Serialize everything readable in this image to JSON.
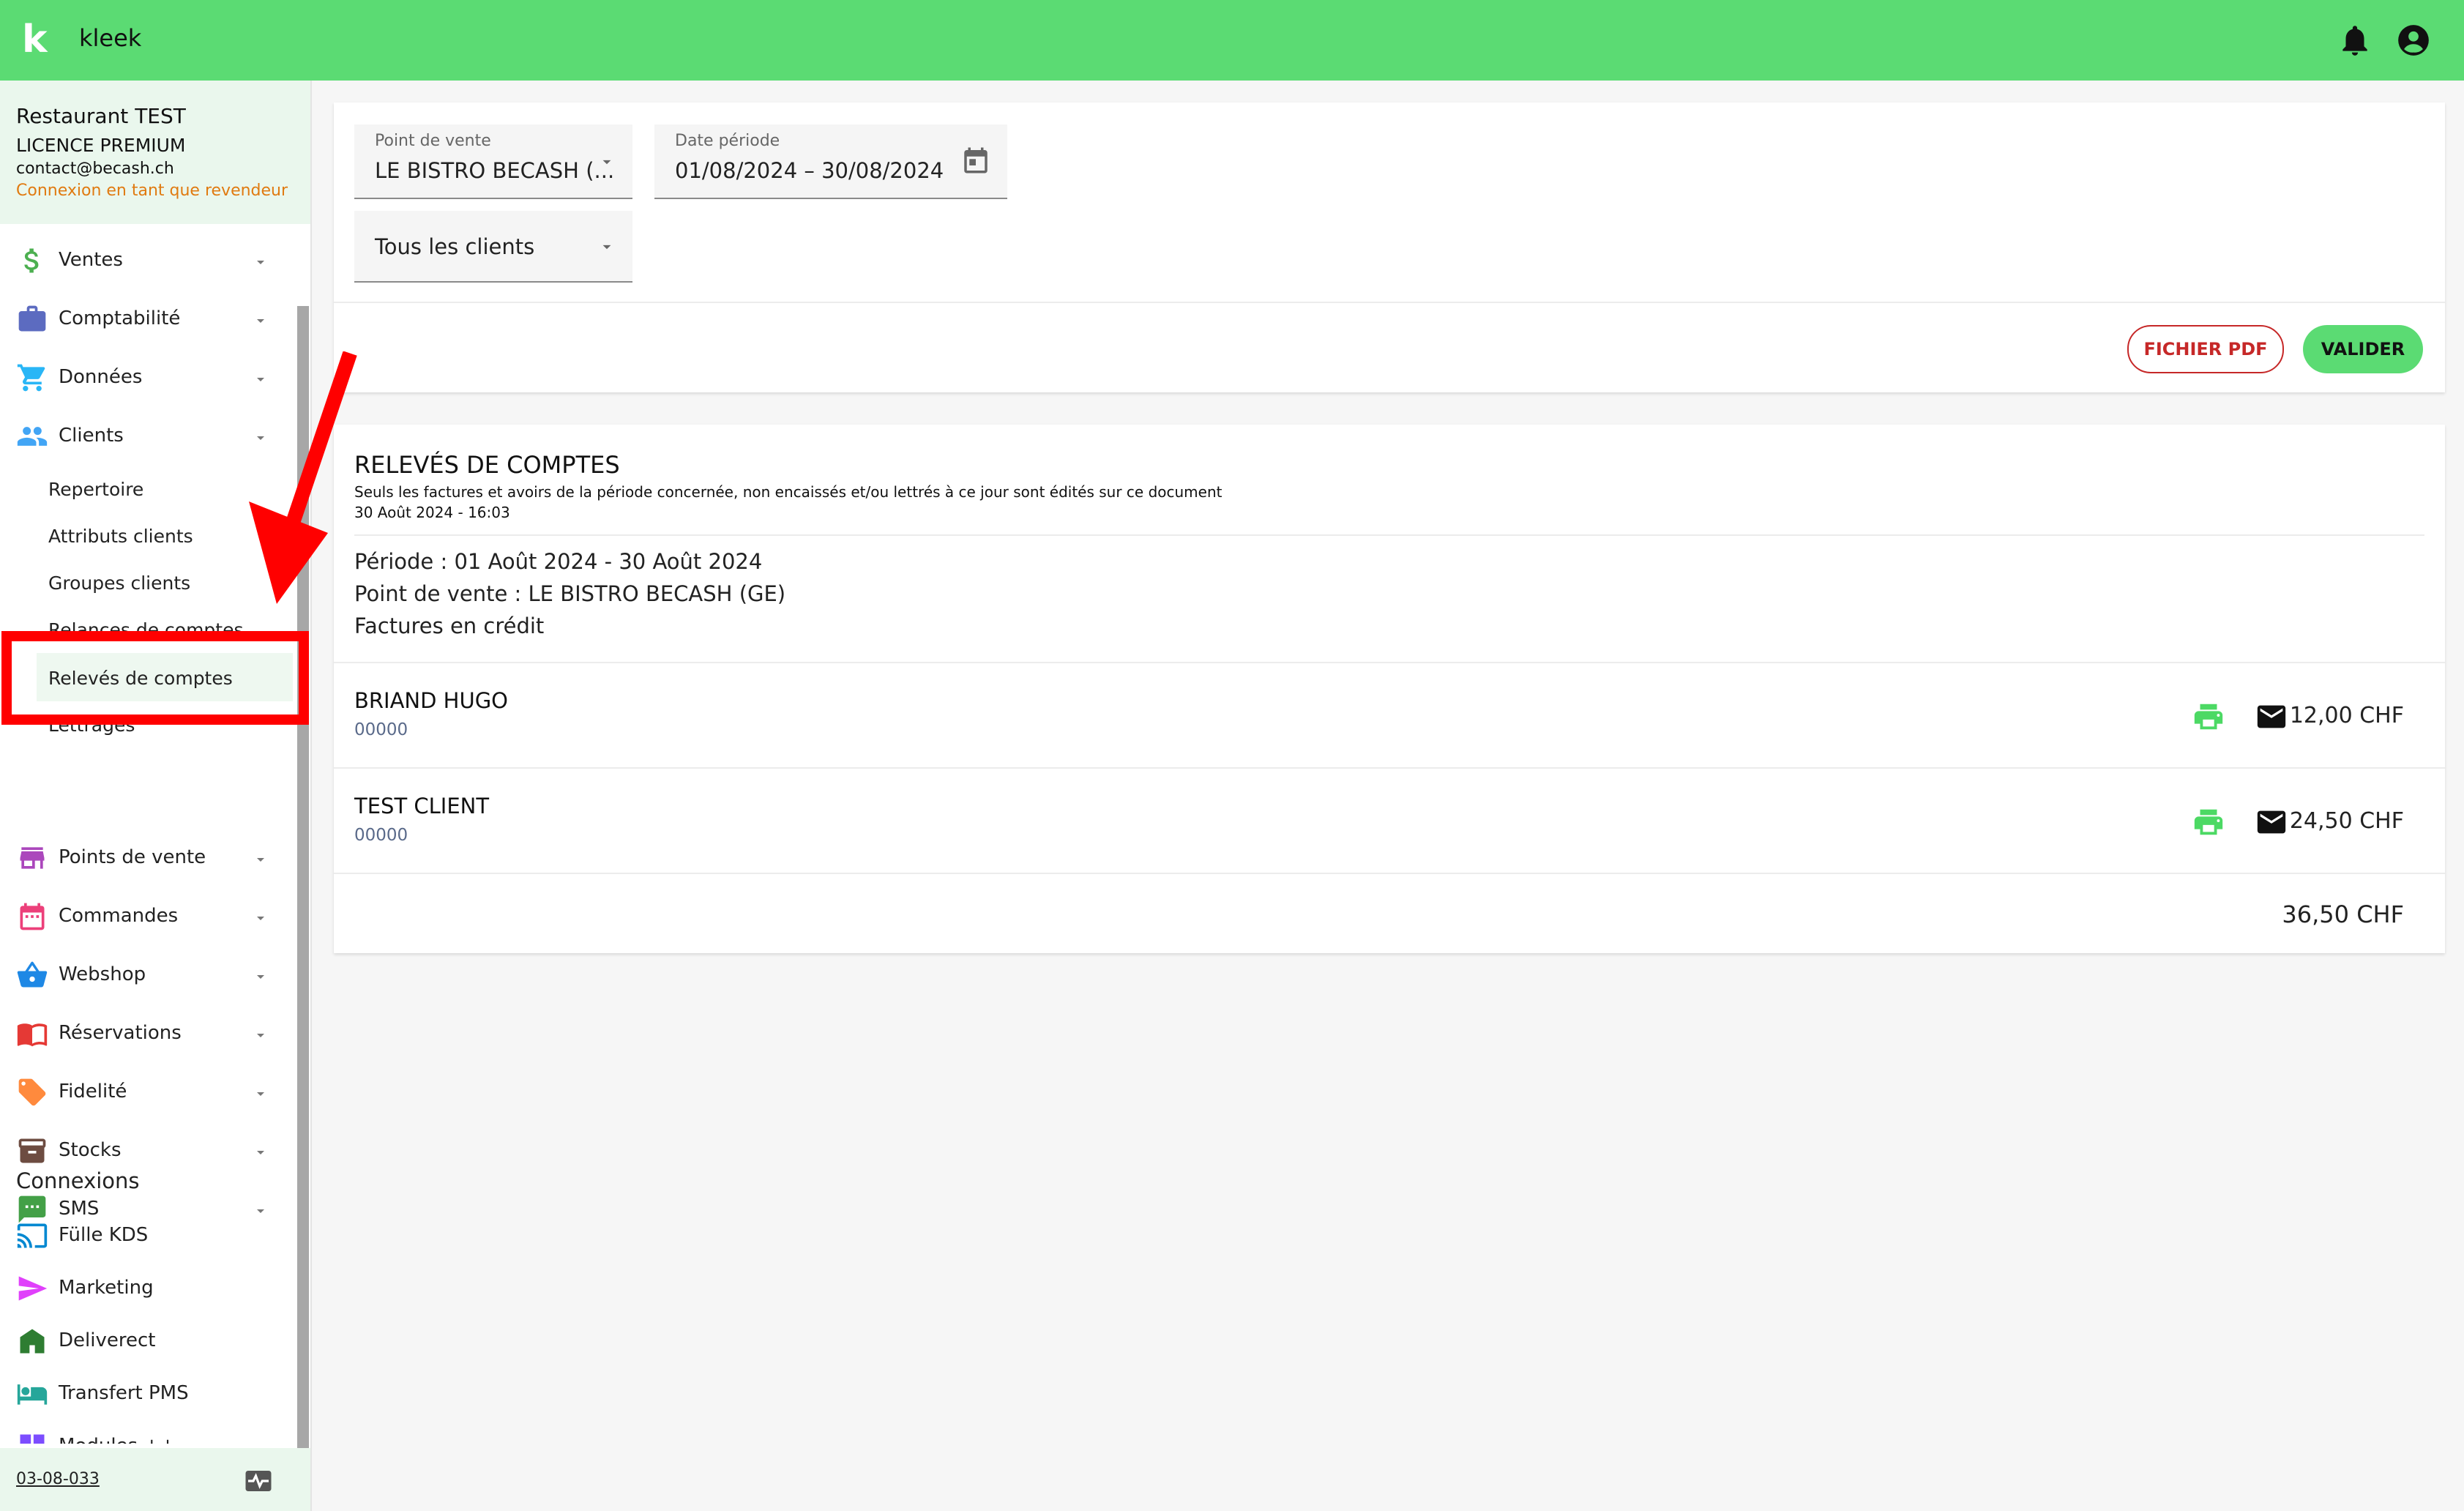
{
  "header": {
    "logo": "k",
    "app_name": "kleek"
  },
  "sidebar": {
    "org_name": "Restaurant TEST",
    "license": "LICENCE PREMIUM",
    "email": "contact@becash.ch",
    "reseller_note": "Connexion en tant que revendeur",
    "items": [
      {
        "label": "Ventes",
        "icon": "dollar-icon",
        "color": "#4caf50"
      },
      {
        "label": "Comptabilité",
        "icon": "briefcase-icon",
        "color": "#5c6bc0"
      },
      {
        "label": "Données",
        "icon": "cart-icon",
        "color": "#29b6f6"
      },
      {
        "label": "Clients",
        "icon": "people-icon",
        "color": "#42a5f5"
      }
    ],
    "clients_sub": [
      "Repertoire",
      "Attributs clients",
      "Groupes clients",
      "Relances de comptes",
      "Relevés de comptes",
      "Lettrages"
    ],
    "items2": [
      {
        "label": "Points de vente",
        "icon": "store-icon",
        "color": "#ab47bc"
      },
      {
        "label": "Commandes",
        "icon": "calendar-icon",
        "color": "#ec407a"
      },
      {
        "label": "Webshop",
        "icon": "basket-icon",
        "color": "#1e88e5"
      },
      {
        "label": "Réservations",
        "icon": "book-icon",
        "color": "#e53935"
      },
      {
        "label": "Fidelité",
        "icon": "tag-icon",
        "color": "#ff8a3d"
      },
      {
        "label": "Stocks",
        "icon": "box-icon",
        "color": "#6d4c41"
      },
      {
        "label": "SMS",
        "icon": "chat-icon",
        "color": "#43a047"
      }
    ],
    "connexions_title": "Connexions",
    "connexions": [
      {
        "label": "Fülle KDS",
        "icon": "cast-icon",
        "color": "#0288d1"
      },
      {
        "label": "Marketing",
        "icon": "send-icon",
        "color": "#e040fb"
      },
      {
        "label": "Deliverect",
        "icon": "home-icon",
        "color": "#2e7d32"
      },
      {
        "label": "Transfert PMS",
        "icon": "bed-icon",
        "color": "#26a69a"
      },
      {
        "label": "Modules ++",
        "icon": "grid-icon",
        "color": "#7c4dff"
      }
    ],
    "version": "03-08-033"
  },
  "filters": {
    "pos_label": "Point de vente",
    "pos_value": "LE BISTRO BECASH (...",
    "date_label": "Date période",
    "date_value": "01/08/2024 – 30/08/2024",
    "clients_value": "Tous les clients",
    "pdf_button": "FICHIER PDF",
    "validate_button": "VALIDER"
  },
  "report": {
    "title": "RELEVÉS DE COMPTES",
    "subtitle": "Seuls les factures et avoirs de la période concernée, non encaissés et/ou lettrés à ce jour sont édités sur ce document",
    "timestamp": "30 Août 2024 - 16:03",
    "period": "Période : 01 Août 2024 - 30 Août 2024",
    "pos": "Point de vente : LE BISTRO BECASH (GE)",
    "type": "Factures en crédit",
    "rows": [
      {
        "name": "BRIAND HUGO",
        "code": "00000",
        "amount": "12,00 CHF"
      },
      {
        "name": "TEST CLIENT",
        "code": "00000",
        "amount": "24,50 CHF"
      }
    ],
    "total": "36,50 CHF"
  },
  "colors": {
    "brand_green": "#5bdb73",
    "annotation_red": "#ff0000"
  }
}
